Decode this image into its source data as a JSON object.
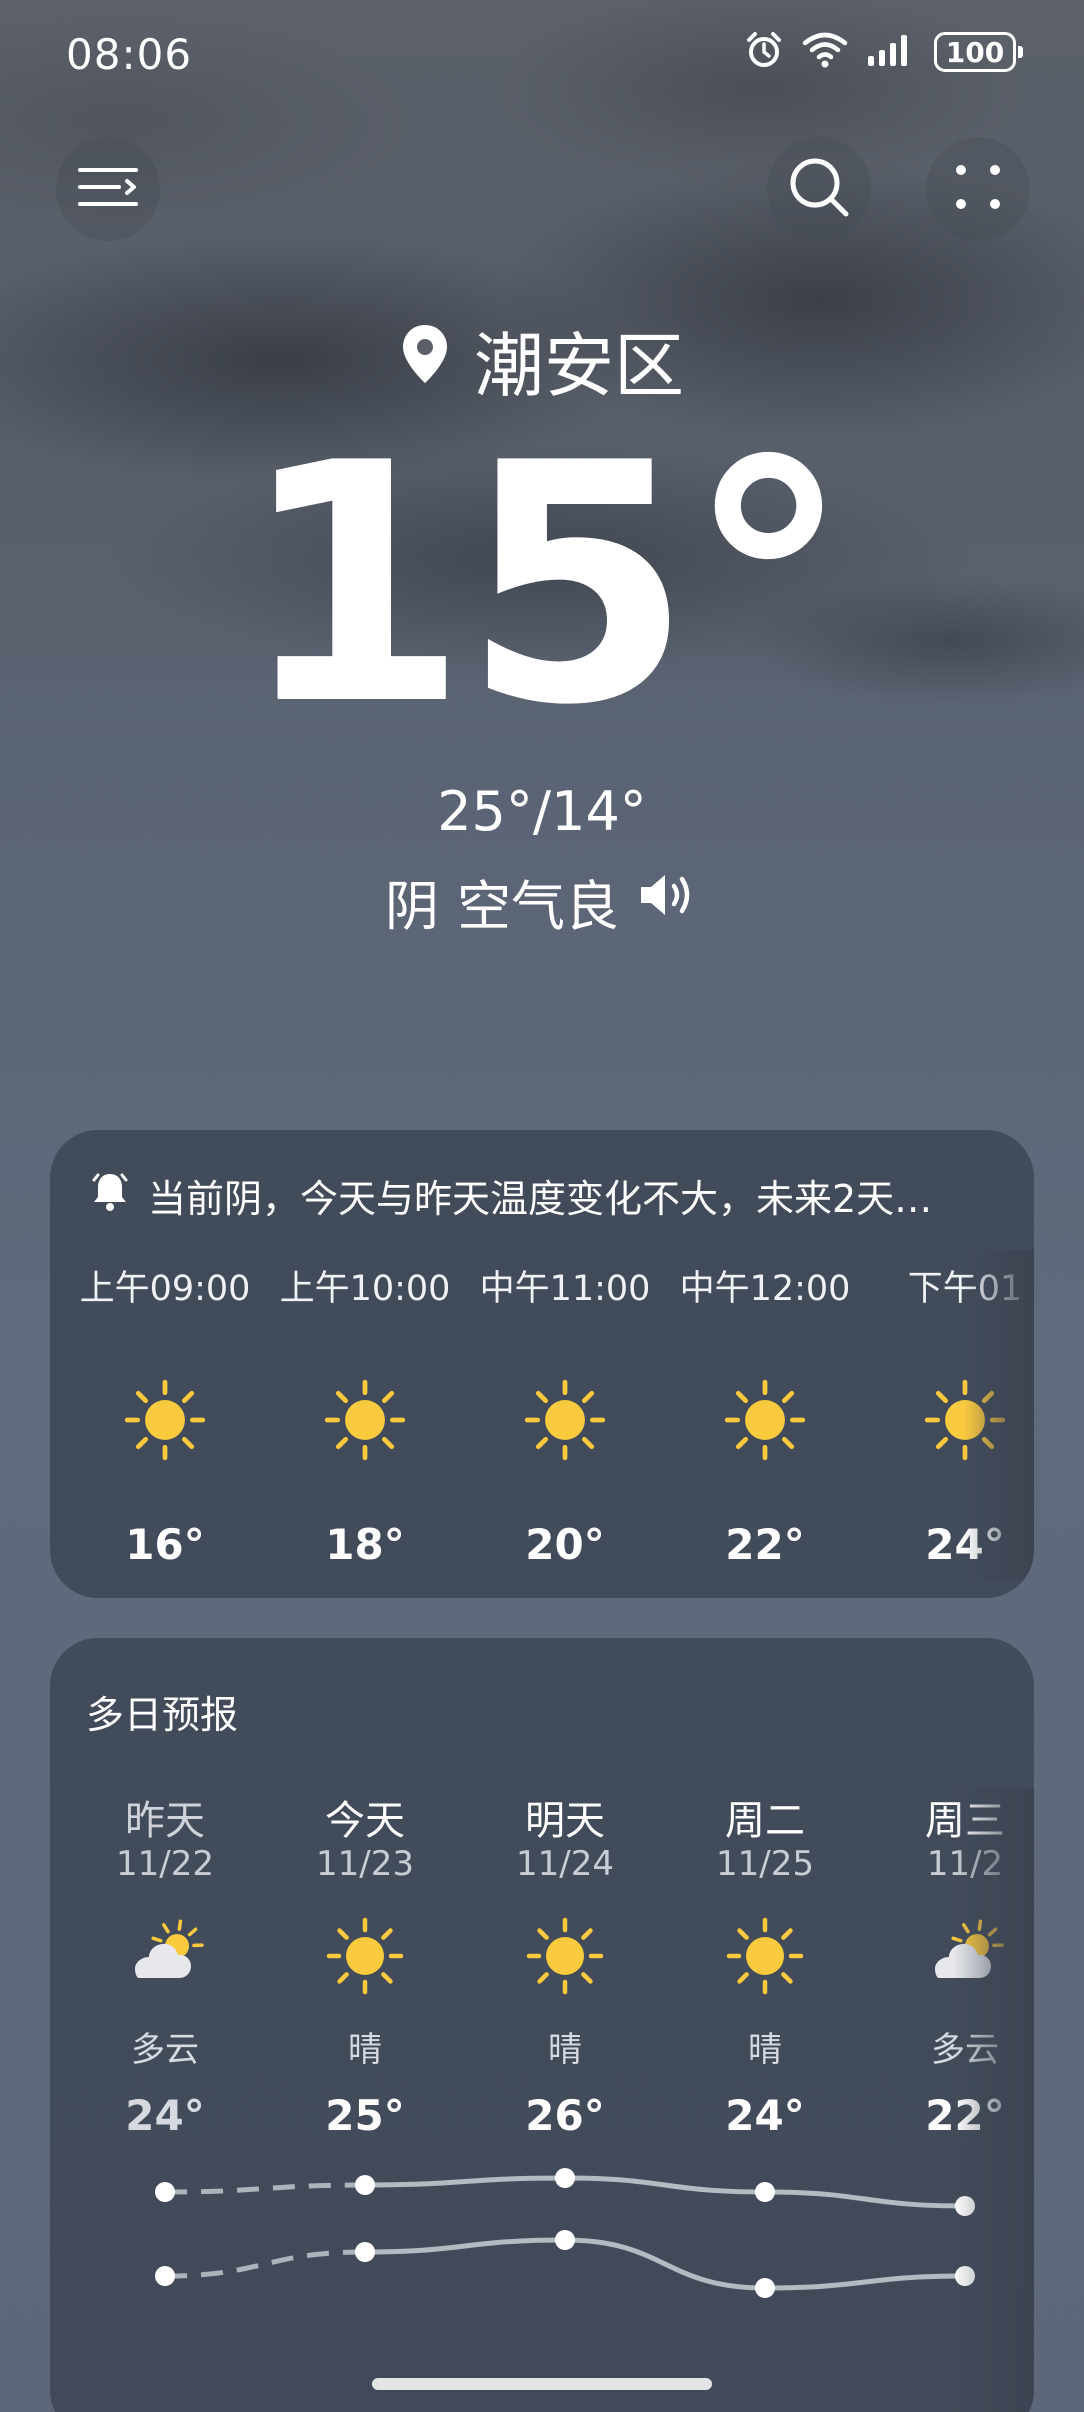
{
  "status_bar": {
    "time": "08:06",
    "battery": "100",
    "icons": [
      "alarm-icon",
      "wifi-icon",
      "signal-icon",
      "battery-icon"
    ]
  },
  "header": {
    "menu_icon": "menu-icon",
    "search_icon": "search-icon",
    "more_icon": "more-dots-icon"
  },
  "current": {
    "location": "潮安区",
    "temperature": "15°",
    "high_low": "25°/14°",
    "condition": "阴",
    "air_quality": "空气良"
  },
  "hourly": {
    "alert_text": "当前阴，今天与昨天温度变化不大，未来2天…",
    "items": [
      {
        "time": "上午09:00",
        "icon": "sun-icon",
        "temp": "16°"
      },
      {
        "time": "上午10:00",
        "icon": "sun-icon",
        "temp": "18°"
      },
      {
        "time": "中午11:00",
        "icon": "sun-icon",
        "temp": "20°"
      },
      {
        "time": "中午12:00",
        "icon": "sun-icon",
        "temp": "22°"
      },
      {
        "time": "下午01",
        "icon": "sun-icon",
        "temp": "24°"
      }
    ]
  },
  "daily": {
    "title": "多日预报",
    "items": [
      {
        "day": "昨天",
        "date": "11/22",
        "icon": "partly-cloudy-icon",
        "condition": "多云",
        "high": "24°",
        "low": "12°",
        "high_value": 24,
        "low_value": 12
      },
      {
        "day": "今天",
        "date": "11/23",
        "icon": "sun-icon",
        "condition": "晴",
        "high": "25°",
        "low": "14°",
        "high_value": 25,
        "low_value": 14
      },
      {
        "day": "明天",
        "date": "11/24",
        "icon": "sun-icon",
        "condition": "晴",
        "high": "26°",
        "low": "15°",
        "high_value": 26,
        "low_value": 15
      },
      {
        "day": "周二",
        "date": "11/25",
        "icon": "sun-icon",
        "condition": "晴",
        "high": "24°",
        "low": "11°",
        "high_value": 24,
        "low_value": 11
      },
      {
        "day": "周三",
        "date": "11/2",
        "icon": "partly-cloudy-icon",
        "condition": "多云",
        "high": "22°",
        "low": "12°",
        "high_value": 22,
        "low_value": 12
      }
    ]
  },
  "colors": {
    "sun": "#f9c93e",
    "card_bg": "#3c4452",
    "text": "#ffffff",
    "secondary_text": "#c8ccd4"
  }
}
